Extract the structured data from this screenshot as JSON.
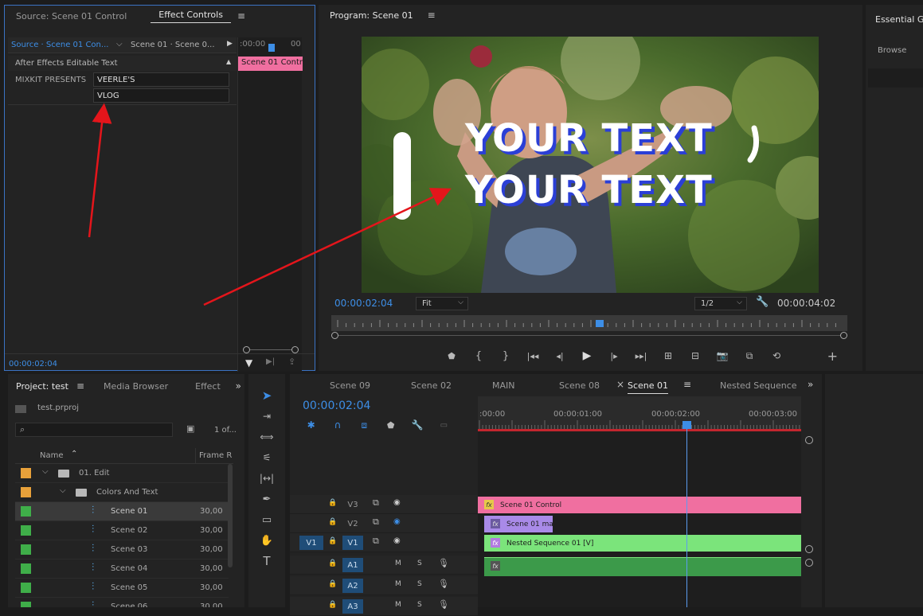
{
  "effect_controls": {
    "tab_source": "Source: Scene 01 Control",
    "tab_effect": "Effect Controls",
    "clip_master": "Source · Scene 01 Con...",
    "clip_sequence": "Scene 01 · Scene 0...",
    "timecode_ruler": ":00:00",
    "timecode_ruler_end": "00",
    "clip_label": "Scene 01 Contr",
    "section_title": "After Effects Editable Text",
    "property_label": "MIXKIT PRESENTS",
    "value_1": "VEERLE'S",
    "value_2": "VLOG",
    "timecode": "00:00:02:04"
  },
  "program": {
    "title": "Program: Scene 01",
    "overlay_line1": "YOUR TEXT",
    "overlay_line2": "YOUR TEXT",
    "timecode": "00:00:02:04",
    "fit": "Fit",
    "resolution": "1/2",
    "duration": "00:00:04:02",
    "playhead_fraction": 0.52
  },
  "essential": {
    "title": "Essential Gr",
    "browse": "Browse"
  },
  "project": {
    "tab_project": "Project: test",
    "tab_media": "Media Browser",
    "tab_effects": "Effect",
    "file": "test.prproj",
    "count": "1 of...",
    "col_name": "Name",
    "col_rate": "Frame R",
    "items": [
      {
        "name": "01. Edit",
        "color": "#e8a13a",
        "type": "folder",
        "rate": ""
      },
      {
        "name": "Colors And Text",
        "color": "#e8a13a",
        "type": "folder",
        "rate": ""
      },
      {
        "name": "Scene 01",
        "color": "#3fae49",
        "type": "seq",
        "rate": "30,00"
      },
      {
        "name": "Scene 02",
        "color": "#3fae49",
        "type": "seq",
        "rate": "30,00"
      },
      {
        "name": "Scene 03",
        "color": "#3fae49",
        "type": "seq",
        "rate": "30,00"
      },
      {
        "name": "Scene 04",
        "color": "#3fae49",
        "type": "seq",
        "rate": "30,00"
      },
      {
        "name": "Scene 05",
        "color": "#3fae49",
        "type": "seq",
        "rate": "30,00"
      },
      {
        "name": "Scene 06",
        "color": "#3fae49",
        "type": "seq",
        "rate": "30,00"
      }
    ]
  },
  "timeline": {
    "tabs": [
      "Scene 09",
      "Scene 02",
      "MAIN",
      "Scene 08",
      "Scene 01",
      "Nested Sequence"
    ],
    "active_tab": "Scene 01",
    "timecode": "00:00:02:04",
    "ruler": [
      ":00:00",
      "00:00:01:00",
      "00:00:02:00",
      "00:00:03:00"
    ],
    "tracks": [
      {
        "label": "V3"
      },
      {
        "label": "V2"
      },
      {
        "label": "V1",
        "src": "V1"
      },
      {
        "label": "A1"
      },
      {
        "label": "A2"
      },
      {
        "label": "A3"
      }
    ],
    "clip_v3": "Scene 01 Control",
    "clip_v2": "Scene 01 ma",
    "clip_v1": "Nested Sequence 01 [V]",
    "colors": {
      "pink": "#f06fa0",
      "purple": "#a98ae8",
      "green": "#7be47b",
      "audio": "#3c9a4a",
      "playhead": "#5b9cf0",
      "accent": "#2d8ceb"
    }
  }
}
